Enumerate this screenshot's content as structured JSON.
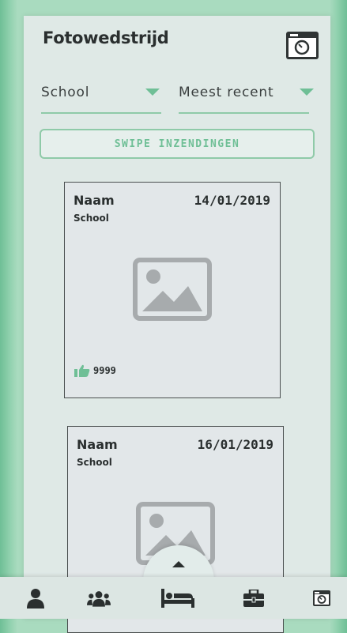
{
  "header": {
    "title": "Fotowedstrijd",
    "camera_icon": "camera-icon"
  },
  "filters": {
    "school": {
      "value": "School"
    },
    "sort": {
      "value": "Meest recent"
    },
    "accent_color": "#6fbf96"
  },
  "swipe_button": {
    "label": "SWIPE INZENDINGEN"
  },
  "cards": [
    {
      "name": "Naam",
      "school": "School",
      "date": "14/01/2019",
      "likes": "9999",
      "image_icon": "image-placeholder-icon"
    },
    {
      "name": "Naam",
      "school": "School",
      "date": "16/01/2019",
      "image_icon": "image-placeholder-icon"
    }
  ],
  "bottom_nav": {
    "items": [
      {
        "icon": "user-icon"
      },
      {
        "icon": "group-icon"
      },
      {
        "icon": "bed-icon",
        "active": true
      },
      {
        "icon": "briefcase-icon"
      },
      {
        "icon": "camera-icon"
      }
    ],
    "fab_icon": "caret-up-icon"
  }
}
